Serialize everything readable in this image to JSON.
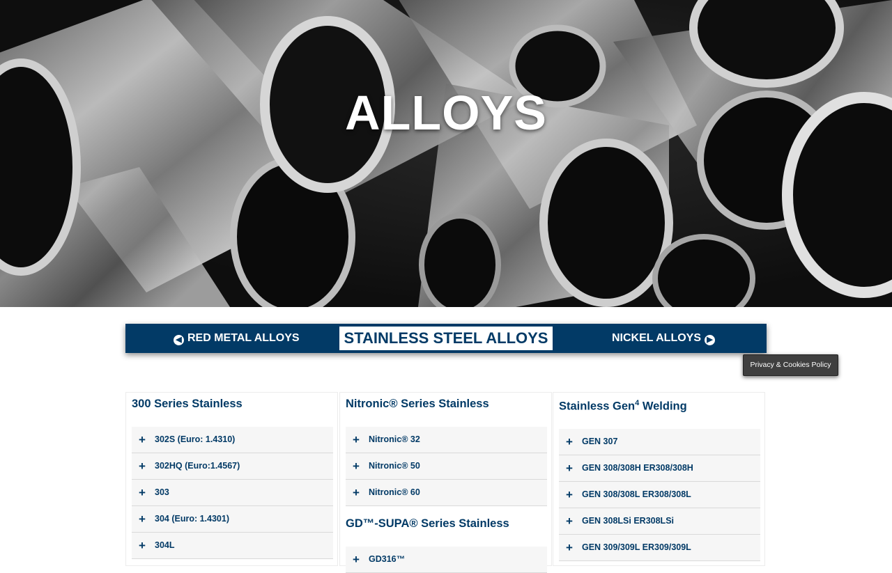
{
  "hero": {
    "title": "ALLOYS"
  },
  "alloy_nav": {
    "prev_label": "RED METAL ALLOYS",
    "current_label": "STAINLESS STEEL ALLOYS",
    "next_label": "NICKEL ALLOYS",
    "prev_icon": "arrow-circle-left-icon",
    "next_icon": "arrow-circle-right-icon"
  },
  "privacy": {
    "label": "Privacy & Cookies Policy"
  },
  "columns": [
    {
      "title": "300 Series Stainless",
      "items": [
        "302S (Euro: 1.4310)",
        "302HQ (Euro:1.4567)",
        "303",
        "304 (Euro: 1.4301)",
        "304L"
      ]
    },
    {
      "title": "Nitronic® Series Stainless",
      "items": [
        "Nitronic® 32",
        "Nitronic® 50",
        "Nitronic® 60"
      ],
      "subtitle": "GD™-SUPA® Series Stainless",
      "sub_items": [
        "GD316™"
      ]
    },
    {
      "title_prefix": "Stainless Gen",
      "title_sup": "4",
      "title_suffix": " Welding",
      "items": [
        "GEN 307",
        "GEN 308/308H ER308/308H",
        "GEN 308/308L ER308/308L",
        "GEN 308LSi ER308LSi",
        "GEN 309/309L ER309/309L"
      ]
    }
  ],
  "colors": {
    "brand_navy": "#023a66",
    "item_bg": "#f6f6f6",
    "privacy_bg": "#3f3f3f"
  }
}
